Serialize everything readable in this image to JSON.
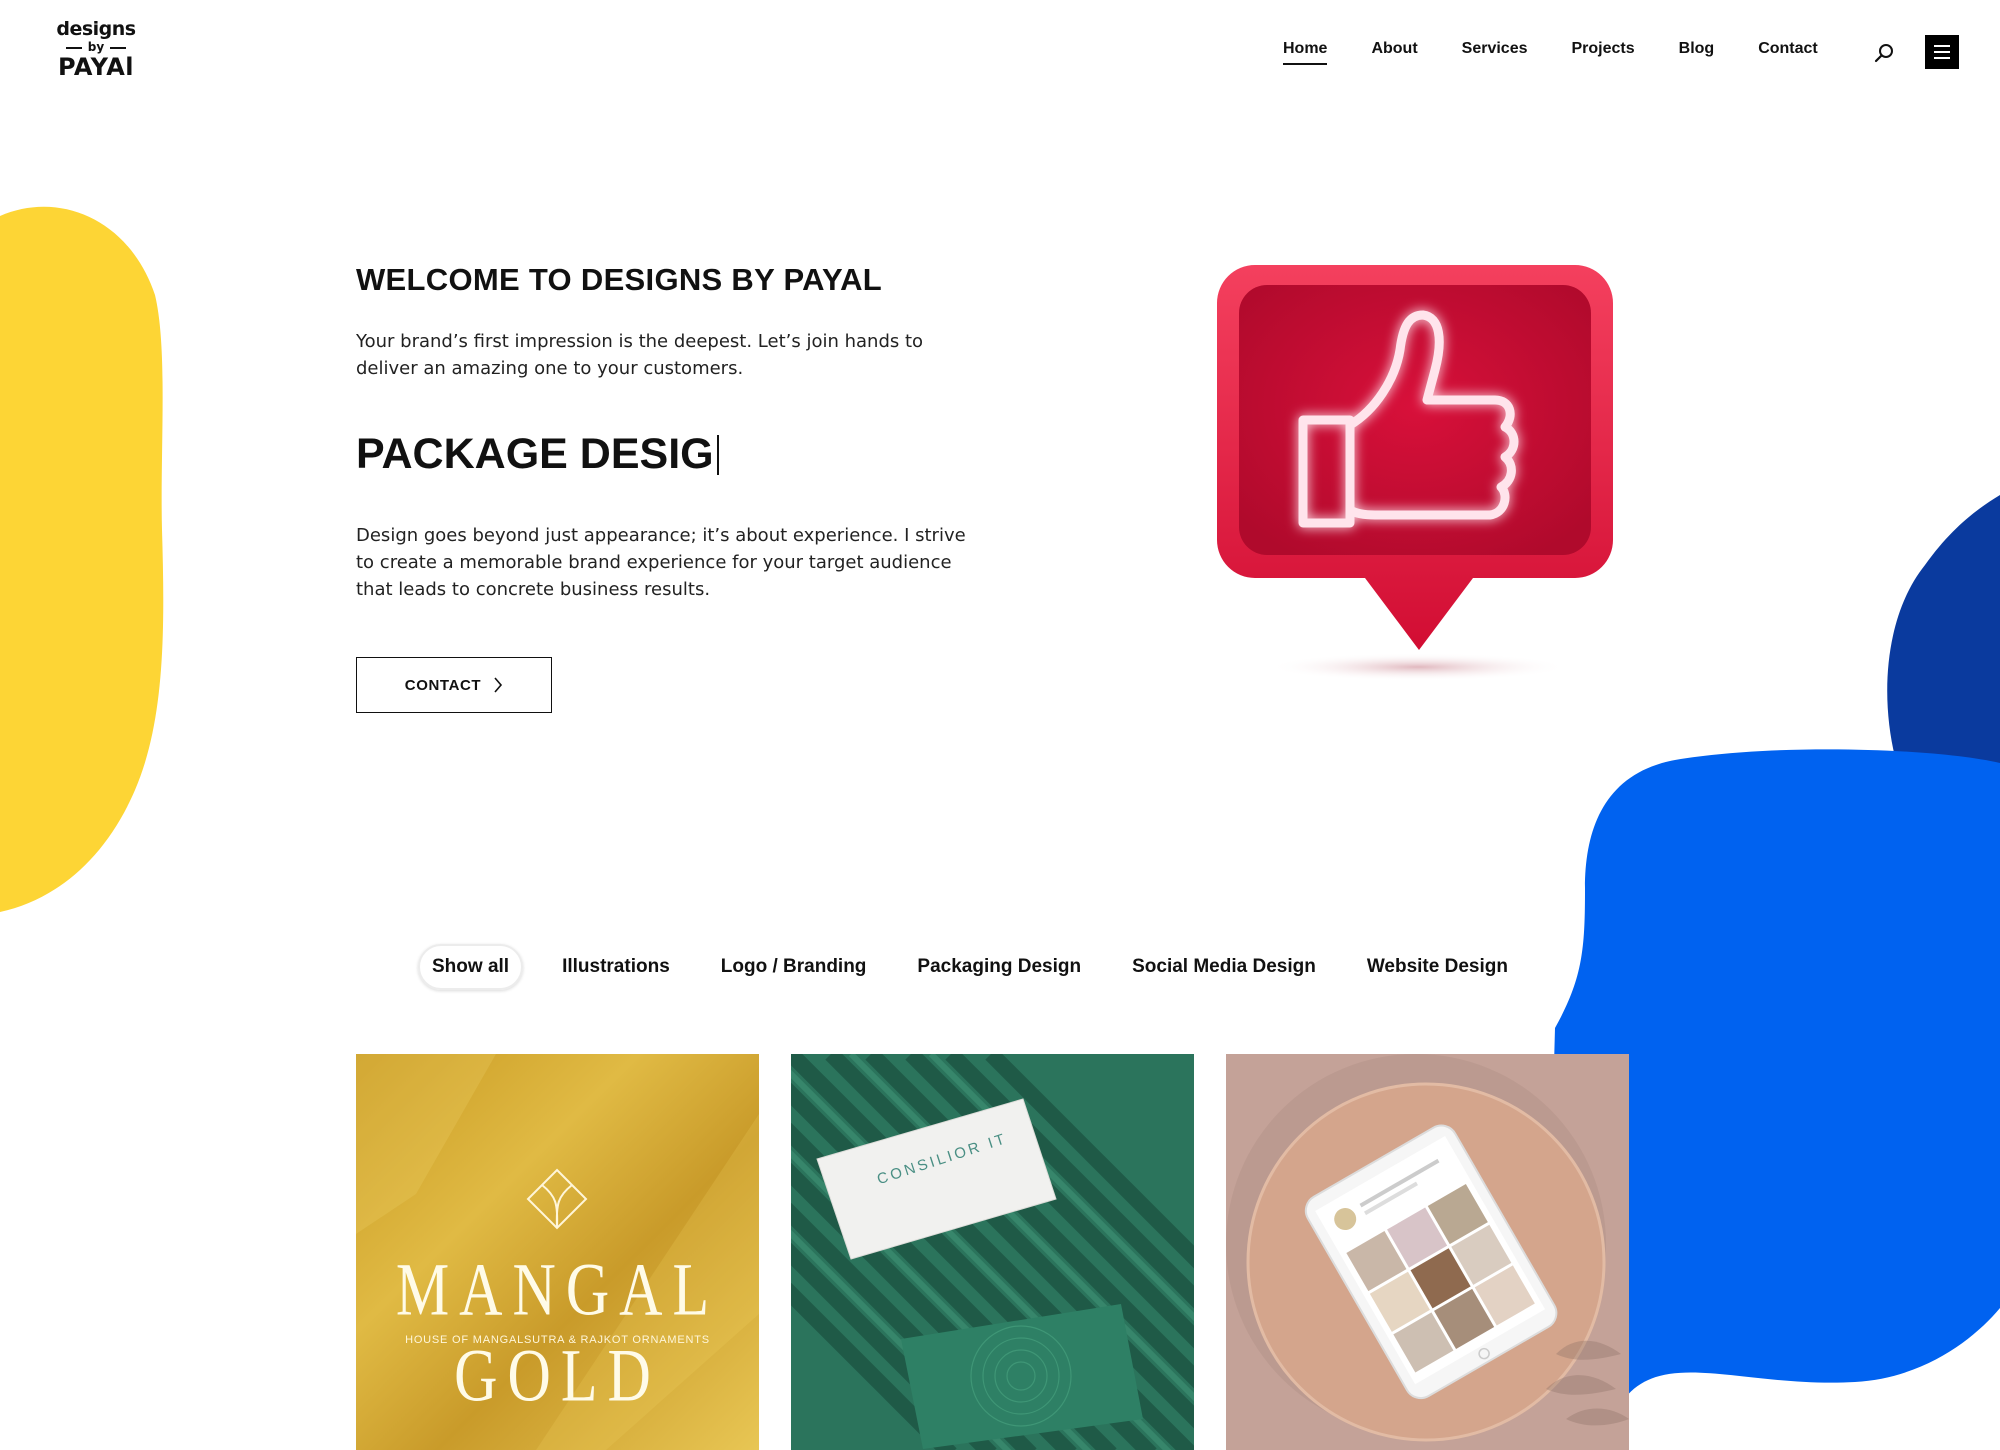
{
  "brand": {
    "logo_top": "designs",
    "logo_mid": "by",
    "logo_bottom": "PAYAl"
  },
  "nav": {
    "items": [
      {
        "label": "Home",
        "active": true
      },
      {
        "label": "About",
        "active": false
      },
      {
        "label": "Services",
        "active": false
      },
      {
        "label": "Projects",
        "active": false
      },
      {
        "label": "Blog",
        "active": false
      },
      {
        "label": "Contact",
        "active": false
      }
    ],
    "search_icon": "search-icon",
    "menu_icon": "hamburger-menu-icon"
  },
  "hero": {
    "title": "WELCOME TO DESIGNS BY PAYAL",
    "intro": "Your brand’s first impression is the deepest. Let’s join hands to deliver an amazing one to your customers.",
    "typed_text": "PACKAGE DESIG",
    "body": "Design goes beyond just appearance; it’s about experience. I strive to create a memorable brand experience for your target audience that leads to concrete business results.",
    "cta_label": "CONTACT",
    "image_icon": "thumbs-up-icon"
  },
  "filters": {
    "items": [
      {
        "label": "Show all",
        "active": true
      },
      {
        "label": "Illustrations",
        "active": false
      },
      {
        "label": "Logo / Branding",
        "active": false
      },
      {
        "label": "Packaging Design",
        "active": false
      },
      {
        "label": "Social Media Design",
        "active": false
      },
      {
        "label": "Website Design",
        "active": false
      }
    ]
  },
  "portfolio": {
    "cards": [
      {
        "title": "MANGAL GOLD",
        "subtitle": "HOUSE OF MANGALSUTRA & RAJKOT ORNAMENTS"
      },
      {
        "title": "CONSILIOR IT"
      },
      {
        "title": ""
      }
    ]
  },
  "colors": {
    "yellow_blob": "#FDD535",
    "navy_blob": "#0A3A9E",
    "blue_blob": "#0062F0",
    "badge_red": "#E8163F",
    "gold": "#D8AE35",
    "green": "#2E7C62",
    "dusty_pink": "#C9A69A"
  }
}
